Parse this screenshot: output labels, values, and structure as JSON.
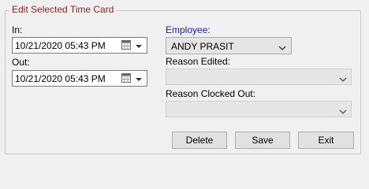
{
  "group": {
    "title": "Edit Selected Time Card"
  },
  "in": {
    "label": "In:",
    "value": "10/21/2020 05:43 PM"
  },
  "out": {
    "label": "Out:",
    "value": "10/21/2020 05:43 PM"
  },
  "employee": {
    "label": "Employee:",
    "value": "ANDY PRASIT"
  },
  "reason_edited": {
    "label": "Reason Edited:",
    "value": ""
  },
  "reason_clocked_out": {
    "label": "Reason Clocked Out:",
    "value": ""
  },
  "buttons": {
    "delete": "Delete",
    "save": "Save",
    "exit": "Exit"
  },
  "colors": {
    "group_title": "#8b1f1f",
    "employee_label": "#1a1aa8",
    "background": "#f0f0f0"
  },
  "icons": {
    "calendar": "calendar-icon",
    "dropdown": "chevron-down-icon"
  }
}
